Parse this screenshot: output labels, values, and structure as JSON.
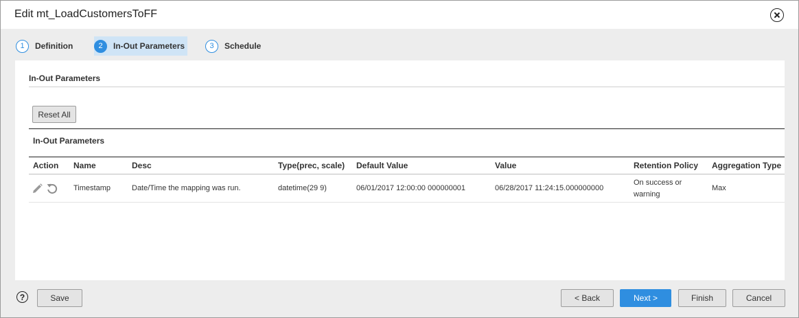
{
  "window": {
    "title": "Edit mt_LoadCustomersToFF"
  },
  "steps": [
    {
      "number": "1",
      "label": "Definition",
      "active": false
    },
    {
      "number": "2",
      "label": "In-Out Parameters",
      "active": true
    },
    {
      "number": "3",
      "label": "Schedule",
      "active": false
    }
  ],
  "section": {
    "title": "In-Out Parameters",
    "reset_all_label": "Reset All"
  },
  "grid": {
    "title": "In-Out Parameters",
    "columns": [
      "Action",
      "Name",
      "Desc",
      "Type(prec, scale)",
      "Default Value",
      "Value",
      "Retention Policy",
      "Aggregation Type"
    ],
    "rows": [
      {
        "actions": [
          "pencil-icon",
          "reset-icon"
        ],
        "name": "Timestamp",
        "desc": "Date/Time the mapping was run.",
        "type": "datetime(29 9)",
        "default_value": "06/01/2017 12:00:00 000000001",
        "value": "06/28/2017 11:24:15.000000000",
        "retention_policy_line1": "On success or",
        "retention_policy_line2": "warning",
        "aggregation_type": "Max"
      }
    ]
  },
  "footer": {
    "help_glyph": "?",
    "save_label": "Save",
    "back_label": "< Back",
    "next_label": "Next >",
    "finish_label": "Finish",
    "cancel_label": "Cancel"
  },
  "colors": {
    "accent": "#2f8ee0",
    "active_step_bg": "#cfe4f6",
    "dialog_bg": "#ededed"
  }
}
